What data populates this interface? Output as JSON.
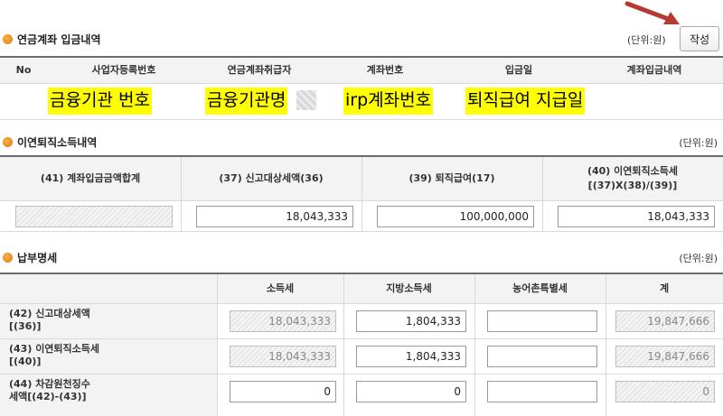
{
  "section1": {
    "title": "연금계좌 입금내역",
    "unit": "(단위:원)",
    "write_button": "작성",
    "columns": [
      "No",
      "사업자등록번호",
      "연금계좌취급자",
      "계좌번호",
      "입금일",
      "계좌입금내역"
    ],
    "highlights": [
      "금융기관 번호",
      "금융기관명",
      "irp계좌번호",
      "퇴직급여 지급일"
    ]
  },
  "section2": {
    "title": "이연퇴직소득내역",
    "unit": "(단위:원)",
    "columns": [
      "(41) 계좌입금금액합계",
      "(37) 신고대상세액(36)",
      "(39) 퇴직급여(17)",
      "(40) 이연퇴직소득세",
      "[(37)X(38)/(39)]"
    ],
    "values": [
      "",
      "18,043,333",
      "100,000,000",
      "18,043,333"
    ]
  },
  "section3": {
    "title": "납부명세",
    "unit": "(단위:원)",
    "columns": [
      "소득세",
      "지방소득세",
      "농어촌특별세",
      "계"
    ],
    "rows": [
      {
        "label1": "(42) 신고대상세액",
        "label2": "[(36)]",
        "income_tax": "18,043,333",
        "local_tax": "1,804,333",
        "rural_tax": "",
        "total": "19,847,666"
      },
      {
        "label1": "(43) 이연퇴직소득세",
        "label2": "[(40)]",
        "income_tax": "18,043,333",
        "local_tax": "1,804,333",
        "rural_tax": "",
        "total": "19,847,666"
      },
      {
        "label1": "(44) 차감원천징수",
        "label2": "세액[(42)-(43)]",
        "income_tax": "0",
        "local_tax": "0",
        "rural_tax": "",
        "total": "0"
      }
    ]
  },
  "colors": {
    "highlight": "#ffff00",
    "bullet": "#e8891a",
    "arrow": "#c0392b",
    "header_bg": "#f3f3f3"
  }
}
